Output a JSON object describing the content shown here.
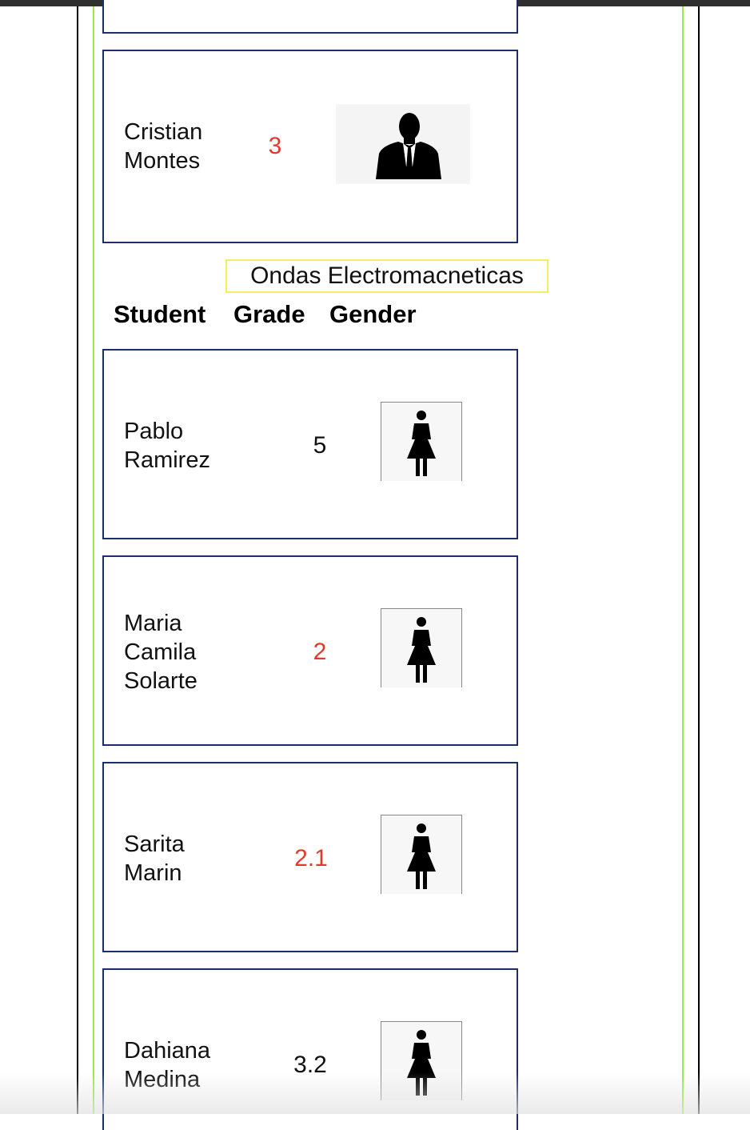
{
  "top_card": {},
  "students_previous": [
    {
      "name": "Cristian\nMontes",
      "grade": "3",
      "gender_icon": "male-silhouette-icon",
      "status": "fail"
    }
  ],
  "subject": {
    "title": "Ondas Electromacneticas",
    "headers": {
      "student": "Student",
      "grade": "Grade",
      "gender": "Gender"
    },
    "students": [
      {
        "name": "Pablo\nRamirez",
        "grade": "5",
        "gender_icon": "female-figure-icon",
        "status": "pass"
      },
      {
        "name": "Maria\nCamila\nSolarte",
        "grade": "2",
        "gender_icon": "female-figure-icon",
        "status": "fail"
      },
      {
        "name": "Sarita\nMarin",
        "grade": "2.1",
        "gender_icon": "female-figure-icon",
        "status": "fail"
      },
      {
        "name": "Dahiana\nMedina",
        "grade": "3.2",
        "gender_icon": "female-figure-icon",
        "status": "pass"
      }
    ]
  },
  "colors": {
    "card_border": "#1b2f6b",
    "title_border": "#f3f05a",
    "failing_grade": "#e03a2a",
    "container_green": "#9be84a"
  }
}
